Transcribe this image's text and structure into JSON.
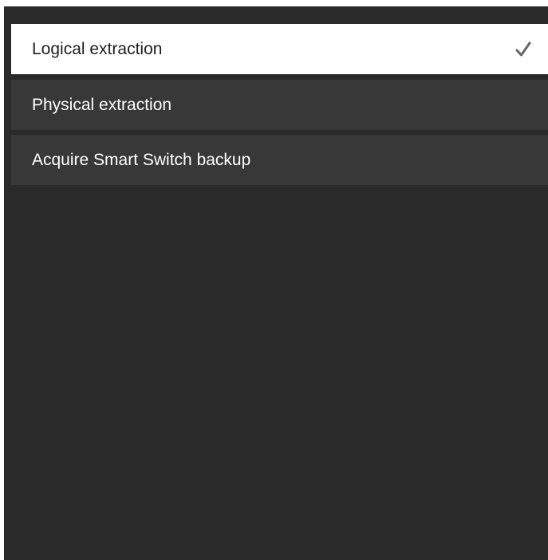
{
  "menu": {
    "options": [
      {
        "label": "Logical extraction",
        "selected": true
      },
      {
        "label": "Physical extraction",
        "selected": false
      },
      {
        "label": "Acquire Smart Switch backup",
        "selected": false
      }
    ]
  },
  "colors": {
    "panel_background": "#2a2a2a",
    "option_background": "#383838",
    "selected_background": "#ffffff",
    "selected_text": "#1e1e1e",
    "option_text": "#ffffff",
    "checkmark": "#666666"
  },
  "icons": {
    "selected_indicator": "checkmark-icon"
  }
}
